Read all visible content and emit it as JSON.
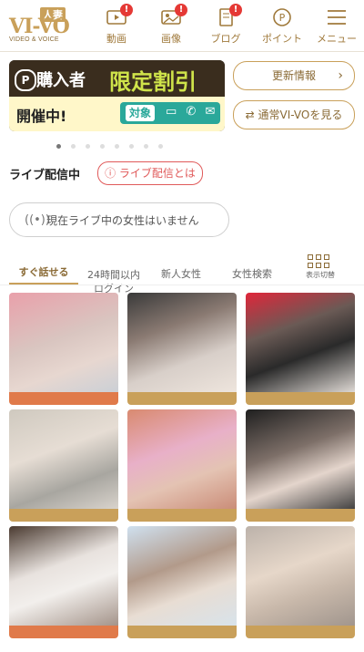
{
  "header": {
    "logo_brand": "VI-VO",
    "logo_hitozuma": "人妻",
    "logo_tagline": "VIDEO & VOICE",
    "nav": [
      {
        "label": "動画",
        "icon": "video-icon",
        "badge": "!"
      },
      {
        "label": "画像",
        "icon": "image-icon",
        "badge": "!"
      },
      {
        "label": "ブログ",
        "icon": "blog-icon",
        "badge": "!"
      },
      {
        "label": "ポイント",
        "icon": "point-icon"
      },
      {
        "label": "メニュー",
        "icon": "menu-icon"
      }
    ]
  },
  "banner": {
    "p_mark": "P",
    "line1": "購入者",
    "line2": "限定割引",
    "line3": "開催中!",
    "target_label": "対象",
    "target_icons": "▭ ✆ ✉"
  },
  "side_buttons": {
    "update_info": "更新情報",
    "normal_view": "⇄ 通常VI-VOを見る",
    "chevron": "›"
  },
  "carousel": {
    "total": 8,
    "active_index": 0
  },
  "live": {
    "title": "ライブ配信中",
    "about": "ⓘ ライブ配信とは",
    "empty_message": "現在ライブ中の女性はいません",
    "empty_icon": "((•))"
  },
  "tabs": [
    {
      "label": "すぐ話せる",
      "active": true
    },
    {
      "label": "24時間以内\nログイン",
      "active": false
    },
    {
      "label": "新人女性",
      "active": false
    },
    {
      "label": "女性検索",
      "active": false
    }
  ],
  "toggle_view_label": "表示切替",
  "grid_colors": {
    "accent": "#c9a05a",
    "card_statuses": [
      {
        "color": "#e07a4a"
      },
      {
        "color": "#c9a05a"
      },
      {
        "color": "#c9a05a"
      },
      {
        "color": "#c9a05a"
      },
      {
        "color": "#c9a05a"
      },
      {
        "color": "#c9a05a"
      },
      {
        "color": "#e07a4a"
      },
      {
        "color": "#c9a05a"
      },
      {
        "color": "#c9a05a"
      }
    ]
  }
}
